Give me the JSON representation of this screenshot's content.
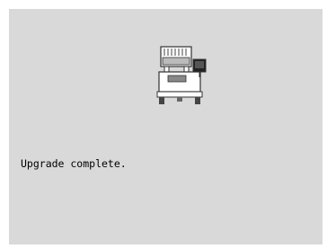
{
  "screen": {
    "message": "Upgrade complete.",
    "icon": "embroidery-machine-icon",
    "background_color": "#d9d9d9"
  }
}
